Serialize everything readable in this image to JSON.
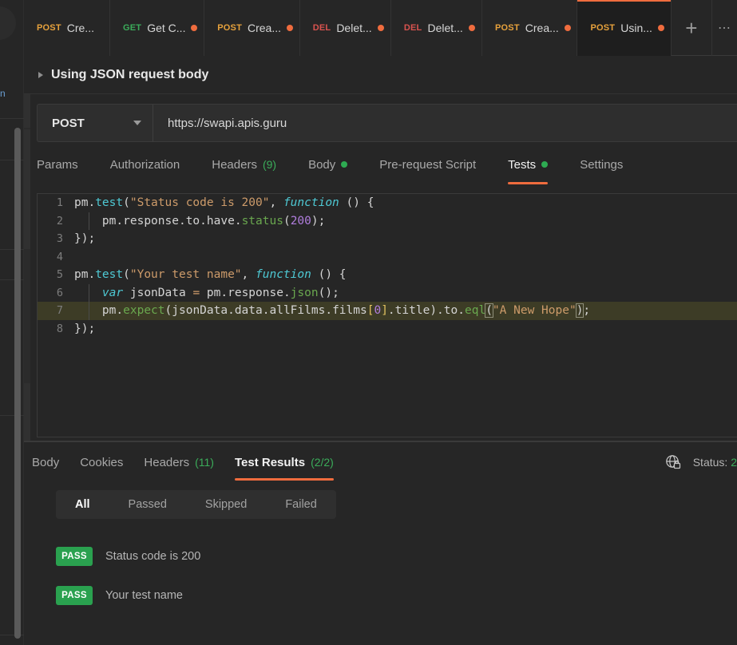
{
  "window": {
    "tabs": [
      {
        "method": "POST",
        "method_class": "m-post",
        "name": "Cre...",
        "dirty": false,
        "active": false
      },
      {
        "method": "GET",
        "method_class": "m-get",
        "name": "Get C...",
        "dirty": true,
        "active": false
      },
      {
        "method": "POST",
        "method_class": "m-post",
        "name": "Crea...",
        "dirty": true,
        "active": false
      },
      {
        "method": "DEL",
        "method_class": "m-del",
        "name": "Delet...",
        "dirty": true,
        "active": false
      },
      {
        "method": "DEL",
        "method_class": "m-del",
        "name": "Delet...",
        "dirty": true,
        "active": false
      },
      {
        "method": "POST",
        "method_class": "m-post",
        "name": "Crea...",
        "dirty": true,
        "active": false
      },
      {
        "method": "POST",
        "method_class": "m-post",
        "name": "Usin...",
        "dirty": true,
        "active": true
      }
    ],
    "new_tab_label": "+",
    "more_tabs_label": "⋯"
  },
  "request": {
    "title": "Using JSON request body",
    "method": "POST",
    "url": "https://swapi.apis.guru",
    "tabs": [
      {
        "label": "Params",
        "active": false,
        "count": "",
        "dot": false
      },
      {
        "label": "Authorization",
        "active": false,
        "count": "",
        "dot": false
      },
      {
        "label": "Headers",
        "active": false,
        "count": "(9)",
        "dot": false
      },
      {
        "label": "Body",
        "active": false,
        "count": "",
        "dot": true
      },
      {
        "label": "Pre-request Script",
        "active": false,
        "count": "",
        "dot": false
      },
      {
        "label": "Tests",
        "active": true,
        "count": "",
        "dot": true
      },
      {
        "label": "Settings",
        "active": false,
        "count": "",
        "dot": false
      }
    ]
  },
  "editor": {
    "lines": [
      {
        "n": "1",
        "highlight": false,
        "indent_guide": false,
        "tokens": [
          {
            "t": "pm",
            "c": "t-obj"
          },
          {
            "t": ".",
            "c": "t-punc"
          },
          {
            "t": "test",
            "c": "t-fn"
          },
          {
            "t": "(",
            "c": "t-punc"
          },
          {
            "t": "\"Status code is 200\"",
            "c": "t-str"
          },
          {
            "t": ", ",
            "c": "t-punc"
          },
          {
            "t": "function",
            "c": "t-kw"
          },
          {
            "t": " () {",
            "c": "t-punc"
          }
        ]
      },
      {
        "n": "2",
        "highlight": false,
        "indent_guide": true,
        "tokens": [
          {
            "t": "    pm",
            "c": "t-obj"
          },
          {
            "t": ".",
            "c": "t-punc"
          },
          {
            "t": "response",
            "c": "t-plain"
          },
          {
            "t": ".",
            "c": "t-punc"
          },
          {
            "t": "to",
            "c": "t-plain"
          },
          {
            "t": ".",
            "c": "t-punc"
          },
          {
            "t": "have",
            "c": "t-plain"
          },
          {
            "t": ".",
            "c": "t-punc"
          },
          {
            "t": "status",
            "c": "t-prop"
          },
          {
            "t": "(",
            "c": "t-punc"
          },
          {
            "t": "200",
            "c": "t-num"
          },
          {
            "t": ");",
            "c": "t-punc"
          }
        ]
      },
      {
        "n": "3",
        "highlight": false,
        "indent_guide": false,
        "tokens": [
          {
            "t": "});",
            "c": "t-punc"
          }
        ]
      },
      {
        "n": "4",
        "highlight": false,
        "indent_guide": false,
        "tokens": []
      },
      {
        "n": "5",
        "highlight": false,
        "indent_guide": false,
        "tokens": [
          {
            "t": "pm",
            "c": "t-obj"
          },
          {
            "t": ".",
            "c": "t-punc"
          },
          {
            "t": "test",
            "c": "t-fn"
          },
          {
            "t": "(",
            "c": "t-punc"
          },
          {
            "t": "\"Your test name\"",
            "c": "t-str"
          },
          {
            "t": ", ",
            "c": "t-punc"
          },
          {
            "t": "function",
            "c": "t-kw"
          },
          {
            "t": " () {",
            "c": "t-punc"
          }
        ]
      },
      {
        "n": "6",
        "highlight": false,
        "indent_guide": true,
        "tokens": [
          {
            "t": "    ",
            "c": "t-plain"
          },
          {
            "t": "var",
            "c": "t-kw"
          },
          {
            "t": " jsonData ",
            "c": "t-plain"
          },
          {
            "t": "=",
            "c": "t-op"
          },
          {
            "t": " pm",
            "c": "t-obj"
          },
          {
            "t": ".",
            "c": "t-punc"
          },
          {
            "t": "response",
            "c": "t-plain"
          },
          {
            "t": ".",
            "c": "t-punc"
          },
          {
            "t": "json",
            "c": "t-prop"
          },
          {
            "t": "();",
            "c": "t-punc"
          }
        ]
      },
      {
        "n": "7",
        "highlight": true,
        "indent_guide": true,
        "tokens": [
          {
            "t": "    pm",
            "c": "t-obj"
          },
          {
            "t": ".",
            "c": "t-punc"
          },
          {
            "t": "expect",
            "c": "t-prop"
          },
          {
            "t": "(",
            "c": "t-punc"
          },
          {
            "t": "jsonData",
            "c": "t-plain"
          },
          {
            "t": ".",
            "c": "t-punc"
          },
          {
            "t": "data",
            "c": "t-plain"
          },
          {
            "t": ".",
            "c": "t-punc"
          },
          {
            "t": "allFilms",
            "c": "t-plain"
          },
          {
            "t": ".",
            "c": "t-punc"
          },
          {
            "t": "films",
            "c": "t-plain"
          },
          {
            "t": "[",
            "c": "t-brk"
          },
          {
            "t": "0",
            "c": "t-num"
          },
          {
            "t": "]",
            "c": "t-brk"
          },
          {
            "t": ".",
            "c": "t-punc"
          },
          {
            "t": "title",
            "c": "t-plain"
          },
          {
            "t": ")",
            "c": "t-punc"
          },
          {
            "t": ".",
            "c": "t-punc"
          },
          {
            "t": "to",
            "c": "t-plain"
          },
          {
            "t": ".",
            "c": "t-punc"
          },
          {
            "t": "eql",
            "c": "t-prop"
          },
          {
            "t": "(",
            "c": "t-match"
          },
          {
            "t": "\"A New Hope\"",
            "c": "t-str"
          },
          {
            "t": ")",
            "c": "t-match"
          },
          {
            "t": ";",
            "c": "t-punc"
          }
        ]
      },
      {
        "n": "8",
        "highlight": false,
        "indent_guide": false,
        "tokens": [
          {
            "t": "});",
            "c": "t-punc"
          }
        ]
      }
    ]
  },
  "response": {
    "tabs": [
      {
        "label": "Body",
        "count": "",
        "active": false
      },
      {
        "label": "Cookies",
        "count": "",
        "active": false
      },
      {
        "label": "Headers",
        "count": "(11)",
        "active": false
      },
      {
        "label": "Test Results",
        "count": "(2/2)",
        "active": true
      }
    ],
    "status_label": "Status:",
    "status_code": "2",
    "filters": [
      {
        "label": "All",
        "active": true
      },
      {
        "label": "Passed",
        "active": false
      },
      {
        "label": "Skipped",
        "active": false
      },
      {
        "label": "Failed",
        "active": false
      }
    ],
    "results": [
      {
        "badge": "PASS",
        "name": "Status code is 200"
      },
      {
        "badge": "PASS",
        "name": "Your test name"
      }
    ]
  },
  "colors": {
    "accent": "#ef6c3e",
    "pass_green": "#2aa14f",
    "count_green": "#3bac5a",
    "bg": "#262626",
    "editor_bg": "#262626",
    "active_line": "#3d3c26"
  }
}
